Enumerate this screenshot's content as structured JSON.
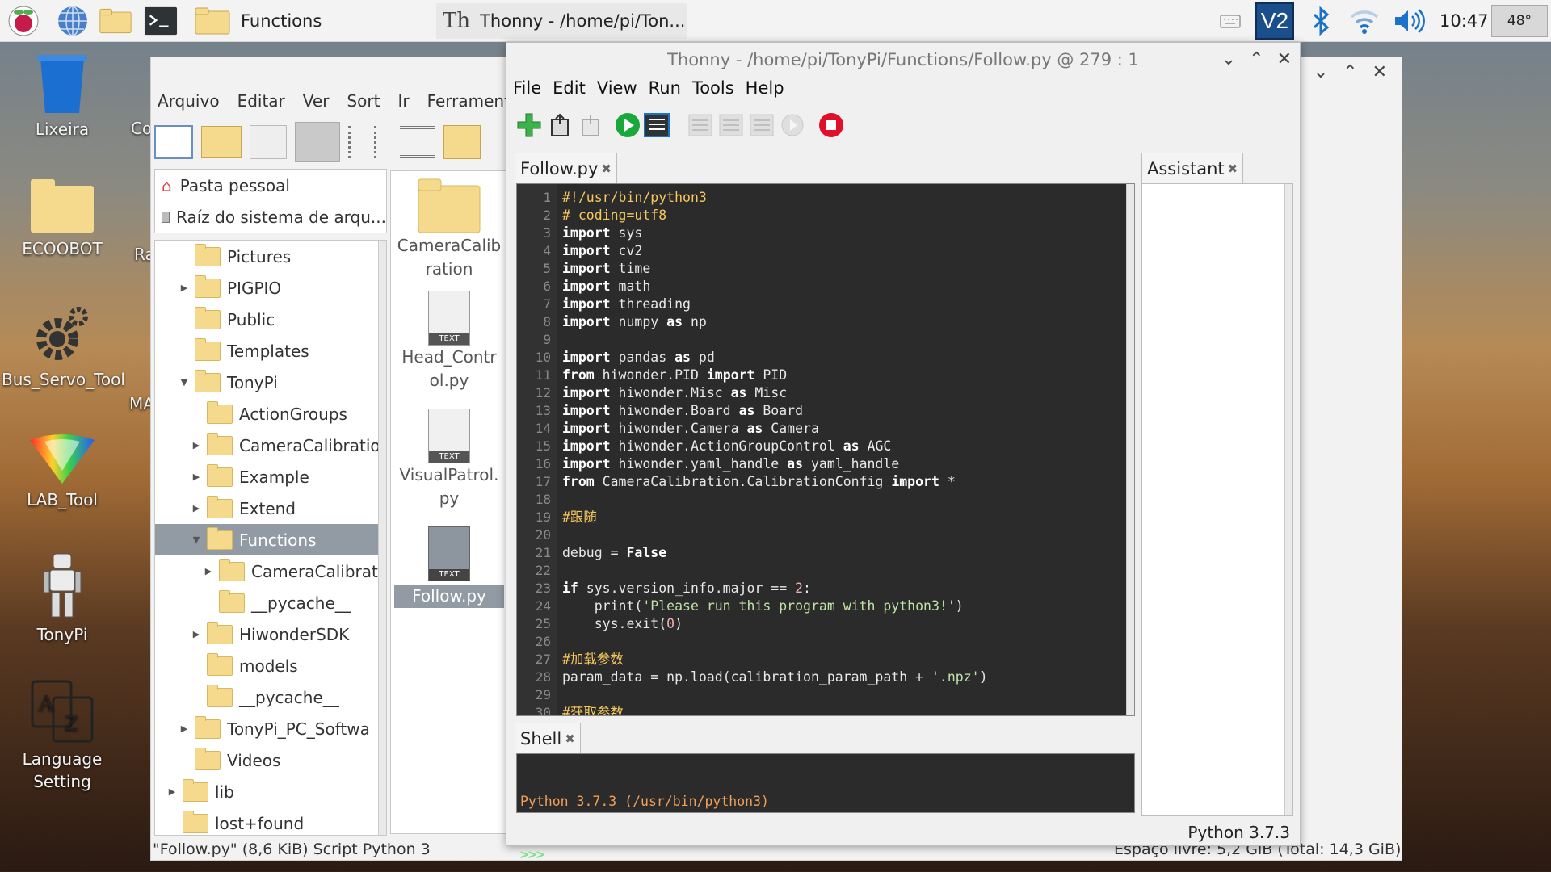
{
  "taskbar": {
    "task1_label": "Functions",
    "task2_label": "Thonny  -  /home/pi/Ton...",
    "clock": "10:47",
    "temperature": "48°",
    "icons": [
      "raspberry-menu-icon",
      "web-browser-icon",
      "file-manager-icon",
      "terminal-icon",
      "keyboard-icon",
      "vnc-icon",
      "bluetooth-icon",
      "wifi-icon",
      "volume-icon"
    ]
  },
  "desktop": {
    "icons": [
      {
        "label": "Lixeira",
        "icon": "trash-icon"
      },
      {
        "label": "ECOOBOT",
        "icon": "folder-icon"
      },
      {
        "label": "Bus_Servo_Tool",
        "icon": "gear-icon"
      },
      {
        "label": "LAB_Tool",
        "icon": "prism-icon"
      },
      {
        "label": "TonyPi",
        "icon": "robot-icon"
      },
      {
        "label": "Language Setting",
        "icon": "language-icon"
      }
    ],
    "partial_labels": [
      "Co",
      "Ra",
      "MA"
    ]
  },
  "file_manager": {
    "menu": [
      "Arquivo",
      "Editar",
      "Ver",
      "Sort",
      "Ir",
      "Ferramentas"
    ],
    "places": [
      "Pasta pessoal",
      "Raíz do sistema de arqu..."
    ],
    "tree": [
      {
        "label": "Pictures",
        "indent": 1,
        "expander": ""
      },
      {
        "label": "PIGPIO",
        "indent": 1,
        "expander": "▶"
      },
      {
        "label": "Public",
        "indent": 1,
        "expander": ""
      },
      {
        "label": "Templates",
        "indent": 1,
        "expander": ""
      },
      {
        "label": "TonyPi",
        "indent": 1,
        "expander": "▼"
      },
      {
        "label": "ActionGroups",
        "indent": 2,
        "expander": ""
      },
      {
        "label": "CameraCalibratio",
        "indent": 2,
        "expander": "▶"
      },
      {
        "label": "Example",
        "indent": 2,
        "expander": "▶"
      },
      {
        "label": "Extend",
        "indent": 2,
        "expander": "▶"
      },
      {
        "label": "Functions",
        "indent": 2,
        "expander": "▼",
        "selected": true
      },
      {
        "label": "CameraCalibrat",
        "indent": 3,
        "expander": "▶"
      },
      {
        "label": "__pycache__",
        "indent": 3,
        "expander": ""
      },
      {
        "label": "HiwonderSDK",
        "indent": 2,
        "expander": "▶"
      },
      {
        "label": "models",
        "indent": 2,
        "expander": ""
      },
      {
        "label": "__pycache__",
        "indent": 2,
        "expander": ""
      },
      {
        "label": "TonyPi_PC_Softwa",
        "indent": 1,
        "expander": "▶"
      },
      {
        "label": "Videos",
        "indent": 1,
        "expander": ""
      },
      {
        "label": "lib",
        "indent": 0,
        "expander": "▶"
      },
      {
        "label": "lost+found",
        "indent": 0,
        "expander": ""
      }
    ],
    "files": [
      "CameraCalibration",
      "Head_Control.py",
      "VisualPatrol.py",
      "Follow.py"
    ],
    "file_badge": "TEXT",
    "status_left": "\"Follow.py\" (8,6 KiB) Script Python 3",
    "status_right": "Espaço livre: 5,2 GiB (Total: 14,3 GiB)"
  },
  "thonny": {
    "title": "Thonny  -  /home/pi/TonyPi/Functions/Follow.py  @  279 : 1",
    "menu": [
      "File",
      "Edit",
      "View",
      "Run",
      "Tools",
      "Help"
    ],
    "editor_tab": "Follow.py",
    "shell_tab": "Shell",
    "assistant_tab": "Assistant",
    "shell_banner": "Python 3.7.3 (/usr/bin/python3)",
    "shell_prompt": ">>>",
    "statusbar": "Python 3.7.3",
    "code": [
      "#!/usr/bin/python3",
      "# coding=utf8",
      "import sys",
      "import cv2",
      "import time",
      "import math",
      "import threading",
      "import numpy as np",
      "",
      "import pandas as pd",
      "from hiwonder.PID import PID",
      "import hiwonder.Misc as Misc",
      "import hiwonder.Board as Board",
      "import hiwonder.Camera as Camera",
      "import hiwonder.ActionGroupControl as AGC",
      "import hiwonder.yaml_handle as yaml_handle",
      "from CameraCalibration.CalibrationConfig import *",
      "",
      "#跟随",
      "",
      "debug = False",
      "",
      "if sys.version_info.major == 2:",
      "    print('Please run this program with python3!')",
      "    sys.exit(0)",
      "",
      "#加载参数",
      "param_data = np.load(calibration_param_path + '.npz')",
      "",
      "#获取参数"
    ]
  }
}
